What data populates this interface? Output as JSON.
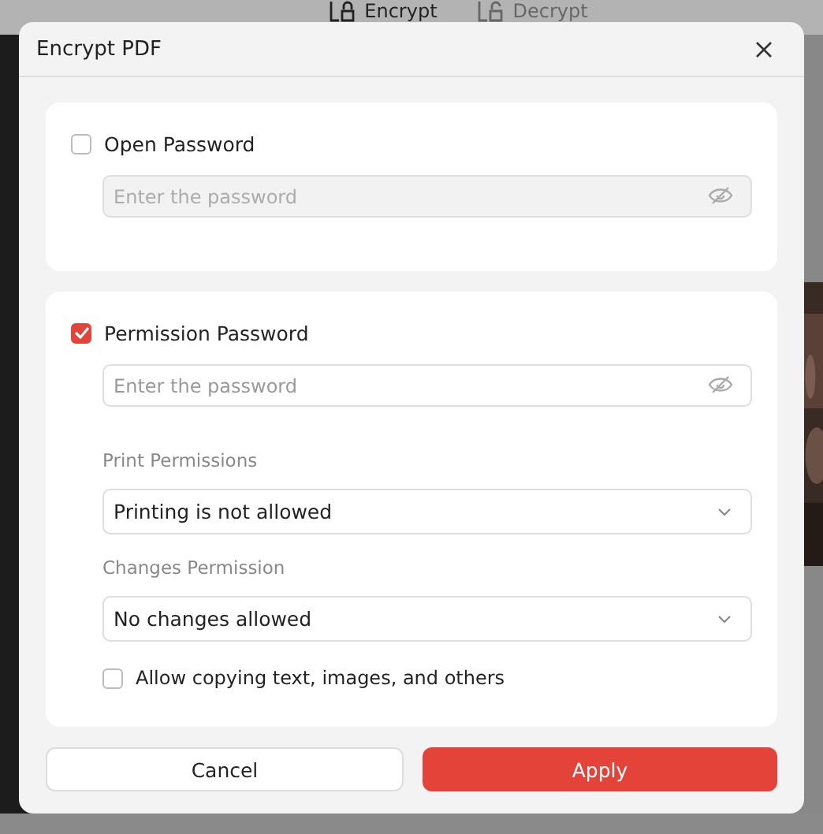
{
  "background_tabs": [
    {
      "label": "Encrypt",
      "selected": true
    },
    {
      "label": "Decrypt",
      "selected": false
    }
  ],
  "dialog": {
    "title": "Encrypt PDF",
    "open_password": {
      "label": "Open Password",
      "checked": false,
      "placeholder": "Enter the password"
    },
    "permission_password": {
      "label": "Permission Password",
      "checked": true,
      "placeholder": "Enter the password",
      "print_label": "Print Permissions",
      "print_value": "Printing is not allowed",
      "changes_label": "Changes Permission",
      "changes_value": "No changes allowed",
      "copy": {
        "label": "Allow copying text, images, and others",
        "checked": false
      }
    },
    "buttons": [
      {
        "label": "Cancel",
        "kind": "secondary"
      },
      {
        "label": "Apply",
        "kind": "primary"
      }
    ]
  }
}
